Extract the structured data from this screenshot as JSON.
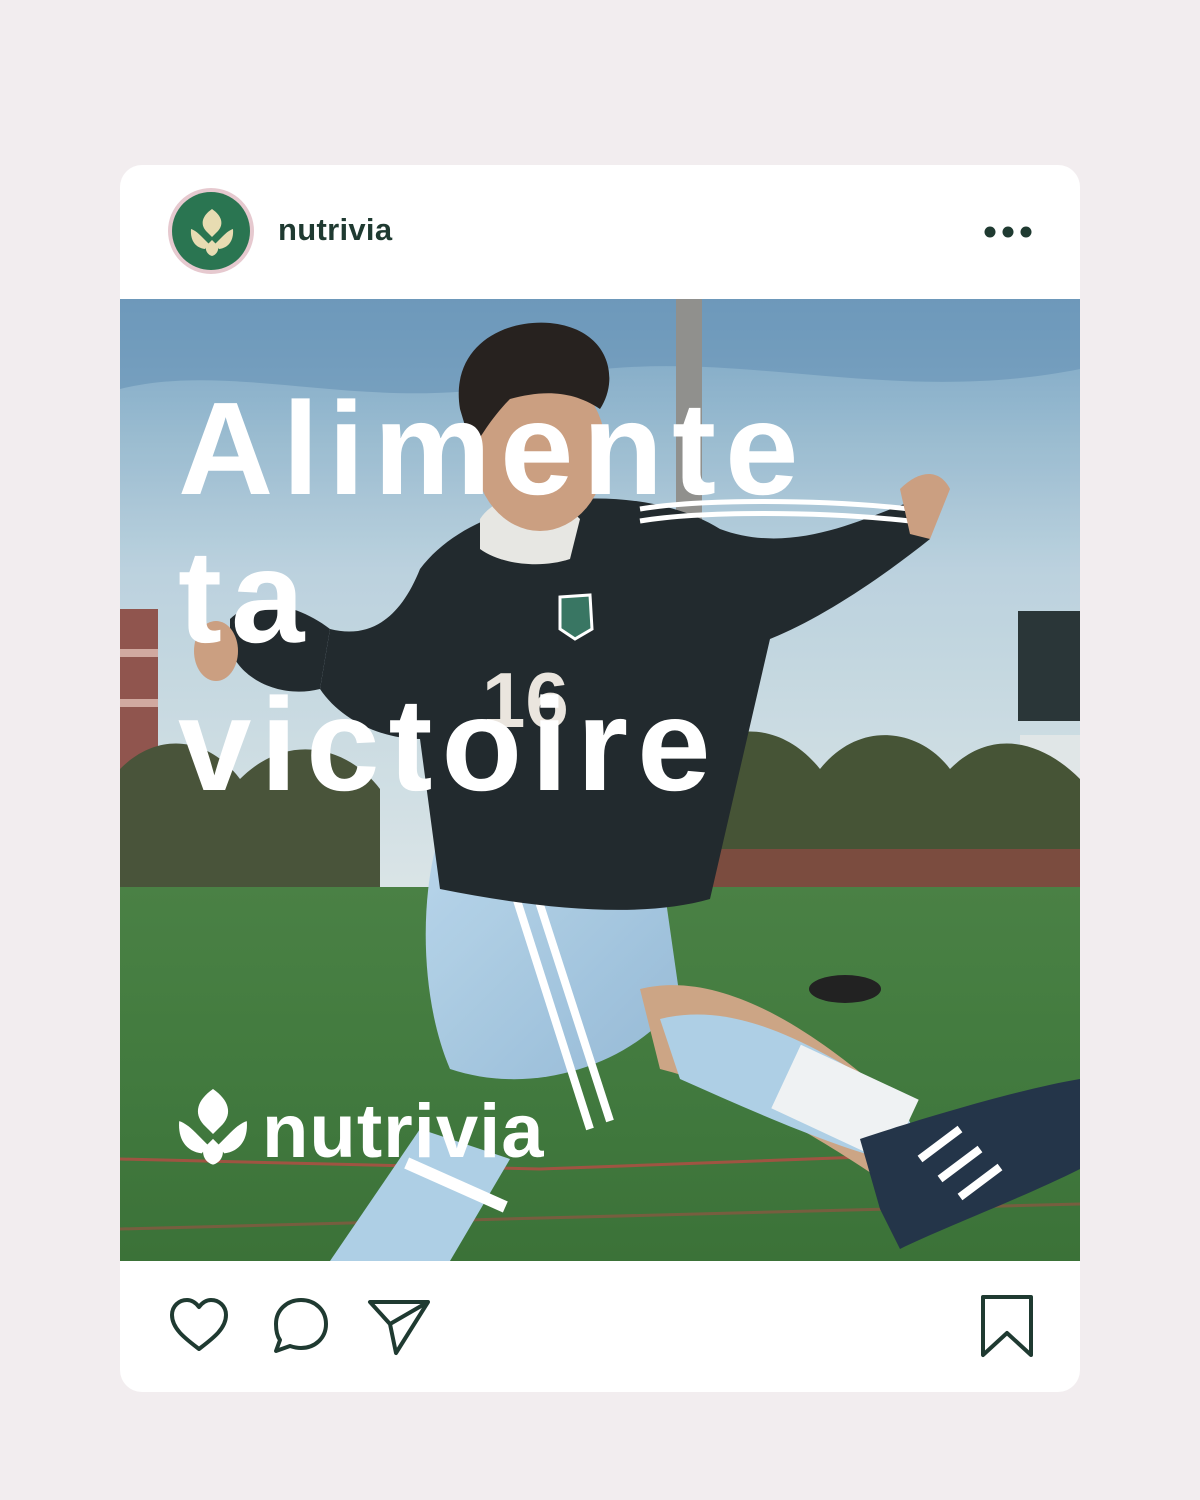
{
  "post": {
    "account": {
      "username": "nutrivia",
      "avatar_icon": "nutrivia-leaf-logo",
      "avatar_bg": "#2a7551",
      "avatar_ring": "#e6c9cf"
    },
    "more_icon": "more-dots-icon",
    "image": {
      "subject": "soccer player in jersey number 16 kicking",
      "jersey_number": "16",
      "headline_lines": [
        "Alimente",
        "ta",
        "victoire"
      ],
      "brand_mark": "nutrivia"
    },
    "actions": {
      "like_icon": "heart-icon",
      "comment_icon": "comment-bubble-icon",
      "share_icon": "send-icon",
      "save_icon": "bookmark-icon"
    }
  },
  "colors": {
    "page_bg": "#f2edef",
    "card_bg": "#ffffff",
    "text_dark": "#1f3a31",
    "brand_green": "#2a7551",
    "leaf_cream": "#e8dcb2"
  }
}
